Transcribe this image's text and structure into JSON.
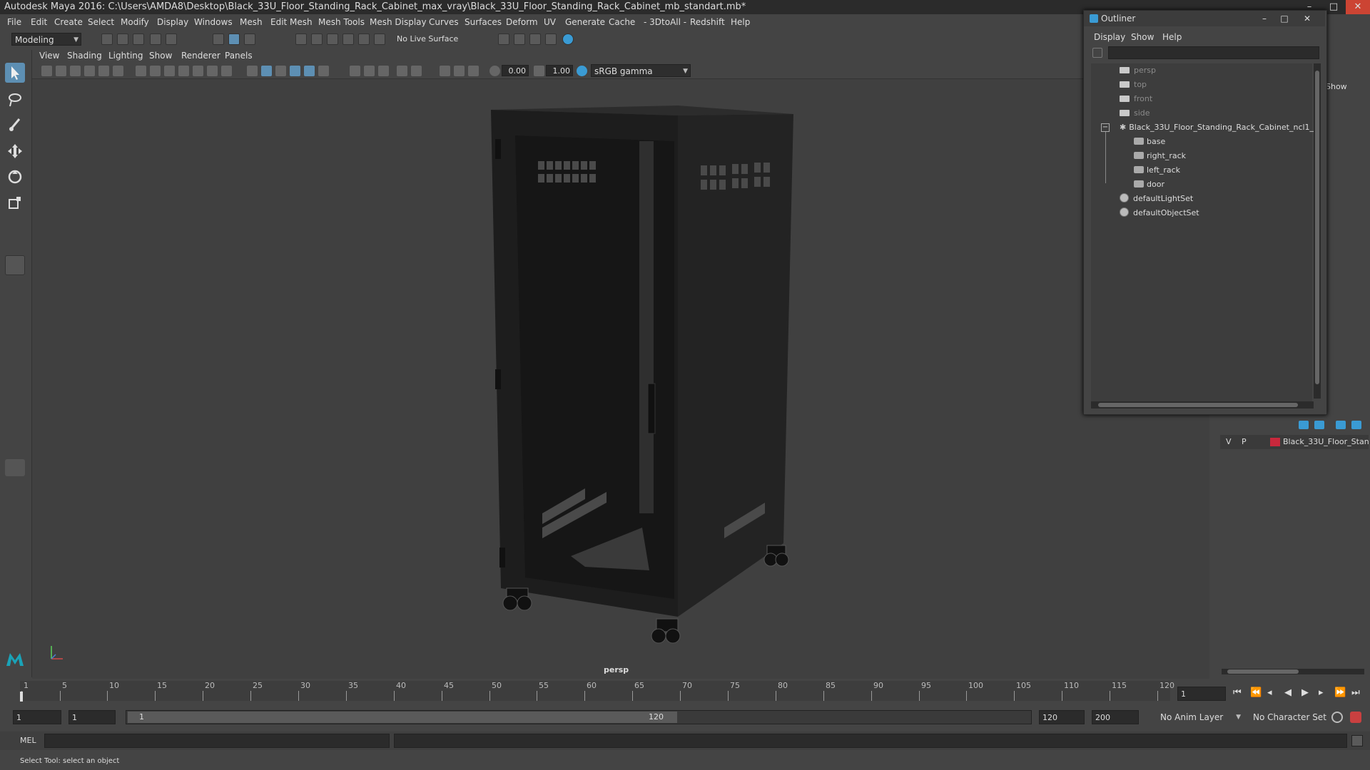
{
  "window": {
    "title": "Autodesk Maya 2016: C:\\Users\\AMDA8\\Desktop\\Black_33U_Floor_Standing_Rack_Cabinet_max_vray\\Black_33U_Floor_Standing_Rack_Cabinet_mb_standart.mb*",
    "minimize": "–",
    "maximize": "□",
    "close": "✕"
  },
  "menubar": [
    "File",
    "Edit",
    "Create",
    "Select",
    "Modify",
    "Display",
    "Windows",
    "Mesh",
    "Edit Mesh",
    "Mesh Tools",
    "Mesh Display",
    "Curves",
    "Surfaces",
    "Deform",
    "UV",
    "Generate",
    "Cache",
    "- 3DtoAll -",
    "Redshift",
    "Help"
  ],
  "toolbar": {
    "mode": "Modeling",
    "live_surface": "No Live Surface"
  },
  "viewport": {
    "menus": [
      "View",
      "Shading",
      "Lighting",
      "Show",
      "Renderer",
      "Panels"
    ],
    "exposure": "0.00",
    "gamma": "1.00",
    "color_space": "sRGB gamma",
    "camera_label": "persp"
  },
  "outliner": {
    "title": "Outliner",
    "menus": [
      "Display",
      "Show",
      "Help"
    ],
    "items": [
      {
        "label": "persp",
        "type": "camera"
      },
      {
        "label": "top",
        "type": "camera"
      },
      {
        "label": "front",
        "type": "camera"
      },
      {
        "label": "side",
        "type": "camera"
      },
      {
        "label": "Black_33U_Floor_Standing_Rack_Cabinet_ncl1_1",
        "type": "group"
      },
      {
        "label": "base",
        "type": "mesh"
      },
      {
        "label": "right_rack",
        "type": "mesh"
      },
      {
        "label": "left_rack",
        "type": "mesh"
      },
      {
        "label": "door",
        "type": "mesh"
      },
      {
        "label": "defaultLightSet",
        "type": "set"
      },
      {
        "label": "defaultObjectSet",
        "type": "set"
      }
    ]
  },
  "layer_editor": {
    "v": "V",
    "p": "P",
    "layer_name": "Black_33U_Floor_Stan",
    "layer_color": "#c8283c",
    "show_label": "Show"
  },
  "timeline": {
    "ticks": [
      "1",
      "5",
      "10",
      "15",
      "20",
      "25",
      "30",
      "35",
      "40",
      "45",
      "50",
      "55",
      "60",
      "65",
      "70",
      "75",
      "80",
      "85",
      "90",
      "95",
      "100",
      "105",
      "110",
      "115",
      "120"
    ],
    "current_frame": "1"
  },
  "range": {
    "start": "1",
    "playback_start": "1",
    "slider_start": "1",
    "slider_end": "120",
    "playback_end": "120",
    "end": "200",
    "anim_layer": "No Anim Layer",
    "character_set": "No Character Set"
  },
  "command": {
    "label": "MEL"
  },
  "help_line": "Select Tool: select an object"
}
